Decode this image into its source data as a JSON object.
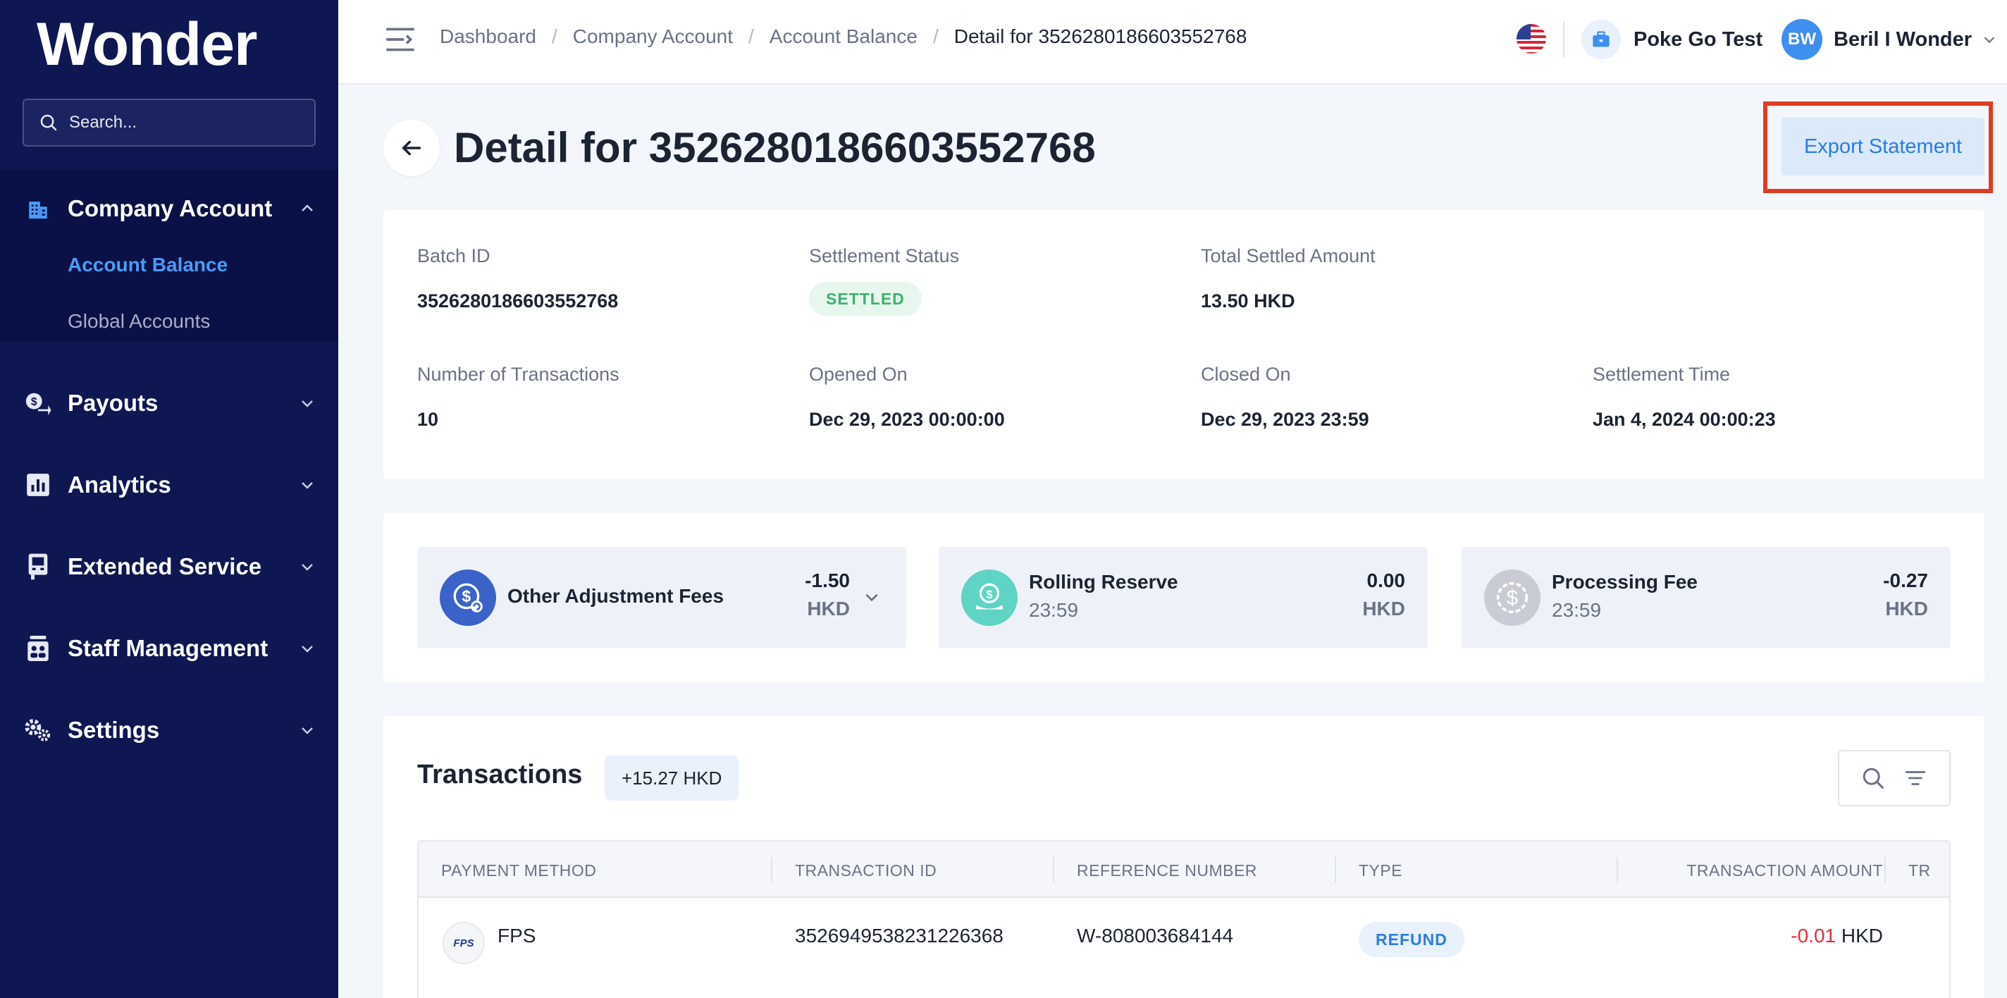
{
  "sidebar": {
    "logo": "Wonder",
    "search_placeholder": "Search...",
    "nav": [
      {
        "label": "Company Account",
        "icon": "building-icon",
        "expanded": true,
        "children": [
          {
            "label": "Account Balance",
            "active": true
          },
          {
            "label": "Global Accounts"
          }
        ]
      },
      {
        "label": "Payouts",
        "icon": "payout-icon"
      },
      {
        "label": "Analytics",
        "icon": "analytics-icon"
      },
      {
        "label": "Extended Service",
        "icon": "terminal-icon"
      },
      {
        "label": "Staff Management",
        "icon": "staff-icon"
      },
      {
        "label": "Settings",
        "icon": "gear-icon"
      }
    ]
  },
  "topbar": {
    "breadcrumbs": [
      "Dashboard",
      "Company Account",
      "Account Balance",
      "Detail for 3526280186603552768"
    ],
    "company_name": "Poke Go Test",
    "user_initials": "BW",
    "user_name": "Beril I Wonder"
  },
  "page": {
    "title": "Detail for 3526280186603552768",
    "export_label": "Export Statement"
  },
  "summary": {
    "batch_id_label": "Batch ID",
    "batch_id": "3526280186603552768",
    "status_label": "Settlement Status",
    "status": "SETTLED",
    "total_label": "Total Settled Amount",
    "total": "13.50 HKD",
    "num_tx_label": "Number of Transactions",
    "num_tx": "10",
    "opened_label": "Opened On",
    "opened": "Dec 29, 2023 00:00:00",
    "closed_label": "Closed On",
    "closed": "Dec 29, 2023 23:59",
    "settle_time_label": "Settlement Time",
    "settle_time": "Jan 4, 2024 00:00:23"
  },
  "fees": [
    {
      "name": "Other Adjustment Fees",
      "time": "",
      "amount": "-1.50",
      "currency": "HKD",
      "color": "#3a62c9"
    },
    {
      "name": "Rolling Reserve",
      "time": "23:59",
      "amount": "0.00",
      "currency": "HKD",
      "color": "#5fd3c4"
    },
    {
      "name": "Processing Fee",
      "time": "23:59",
      "amount": "-0.27",
      "currency": "HKD",
      "color": "#c9ccd4"
    }
  ],
  "transactions": {
    "title": "Transactions",
    "total": "+15.27 HKD",
    "columns": [
      "PAYMENT METHOD",
      "TRANSACTION ID",
      "REFERENCE NUMBER",
      "TYPE",
      "TRANSACTION AMOUNT",
      "TR"
    ],
    "rows": [
      {
        "method": "FPS",
        "method_logo": "FPS",
        "tx_id": "3526949538231226368",
        "ref": "W-808003684144",
        "type": "REFUND",
        "amount": "-0.01",
        "currency": "HKD"
      }
    ]
  }
}
